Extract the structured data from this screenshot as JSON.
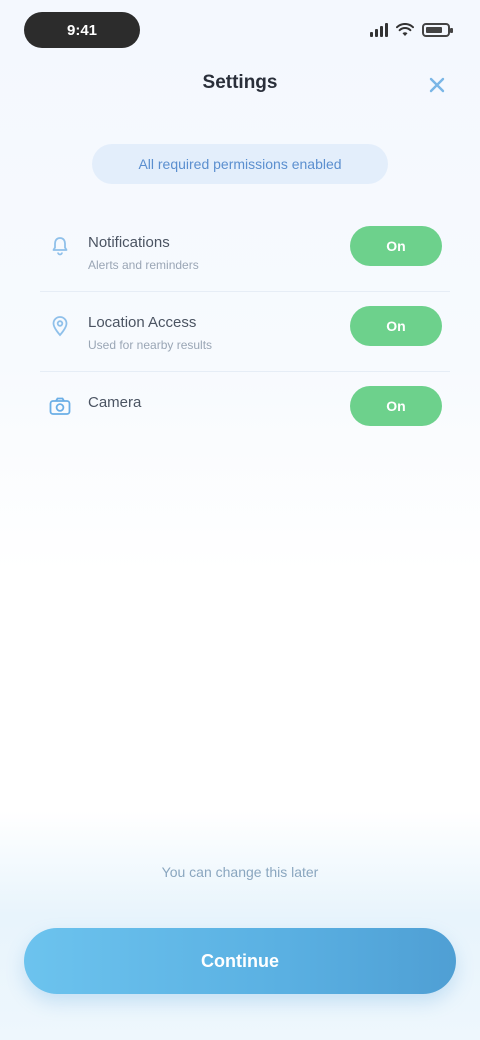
{
  "status_bar": {
    "time": "9:41"
  },
  "header": {
    "title": "Settings",
    "close_icon": "close-icon"
  },
  "summary": {
    "text": "All required permissions enabled"
  },
  "items": [
    {
      "icon": "bell-icon",
      "label": "Notifications",
      "subtitle": "Alerts and reminders",
      "status": "On"
    },
    {
      "icon": "location-icon",
      "label": "Location Access",
      "subtitle": "Used for nearby results",
      "status": "On"
    },
    {
      "icon": "camera-icon",
      "label": "Camera",
      "subtitle": "",
      "status": "On"
    }
  ],
  "footer": {
    "hint": "You can change this later",
    "primary_label": "Continue"
  },
  "colors": {
    "accent": "#5ab0e2",
    "on_chip": "#6dd18c",
    "background": "#f4f8fe"
  }
}
